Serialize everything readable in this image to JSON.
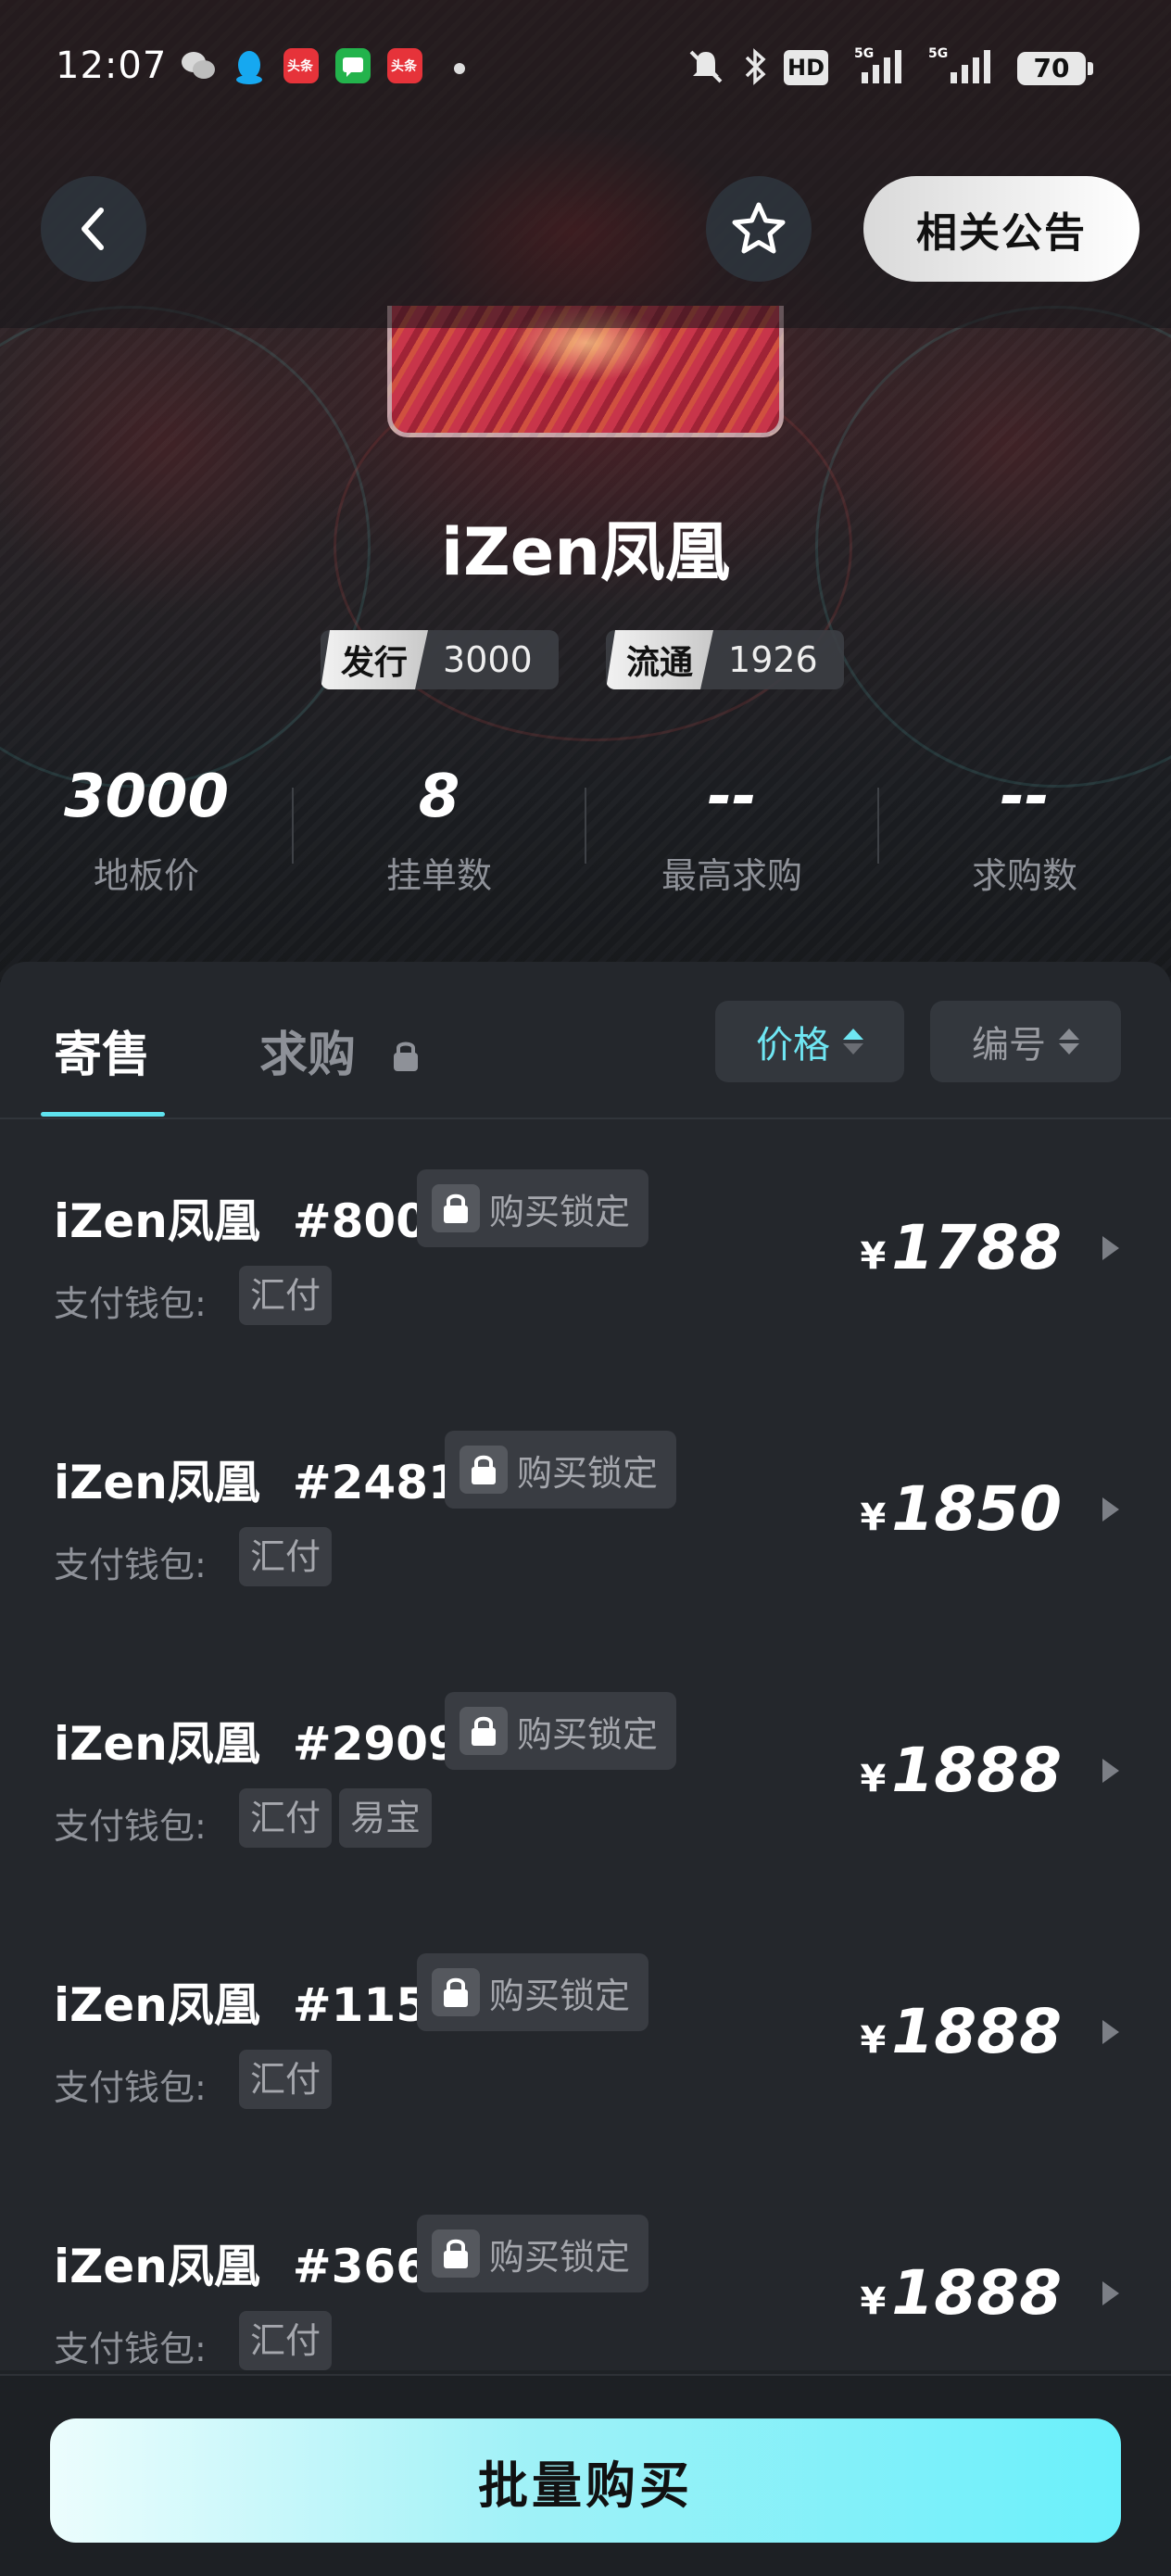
{
  "status_bar": {
    "time": "12:07",
    "apps": [
      "wechat-icon",
      "qq-icon",
      "toutiao-icon",
      "message-icon",
      "toutiao-icon"
    ],
    "toutiao_label": "头条",
    "network": "5G",
    "hd_label": "HD",
    "battery": "70"
  },
  "nav": {
    "notice_label": "相关公告"
  },
  "collection": {
    "title": "iZen凤凰",
    "issue_label": "发行",
    "issue_value": "3000",
    "circulation_label": "流通",
    "circulation_value": "1926"
  },
  "stats": [
    {
      "value": "3000",
      "label": "地板价"
    },
    {
      "value": "8",
      "label": "挂单数"
    },
    {
      "value": "--",
      "label": "最高求购"
    },
    {
      "value": "--",
      "label": "求购数"
    }
  ],
  "tabs": {
    "sell": "寄售",
    "buy": "求购",
    "sort_price": "价格",
    "sort_number": "编号"
  },
  "listing_common": {
    "lock_label": "购买锁定",
    "wallet_label": "支付钱包:",
    "currency": "¥"
  },
  "listings": [
    {
      "name": "iZen凤凰",
      "number": "#800",
      "wallets": [
        "汇付"
      ],
      "price": "1788"
    },
    {
      "name": "iZen凤凰",
      "number": "#2481",
      "wallets": [
        "汇付"
      ],
      "price": "1850"
    },
    {
      "name": "iZen凤凰",
      "number": "#2909",
      "wallets": [
        "汇付",
        "易宝"
      ],
      "price": "1888"
    },
    {
      "name": "iZen凤凰",
      "number": "#115",
      "wallets": [
        "汇付"
      ],
      "price": "1888"
    },
    {
      "name": "iZen凤凰",
      "number": "#366",
      "wallets": [
        "汇付"
      ],
      "price": "1888"
    }
  ],
  "bulk_buy_label": "批量购买",
  "colors": {
    "accent": "#5fe3ef",
    "background": "#24272c"
  }
}
